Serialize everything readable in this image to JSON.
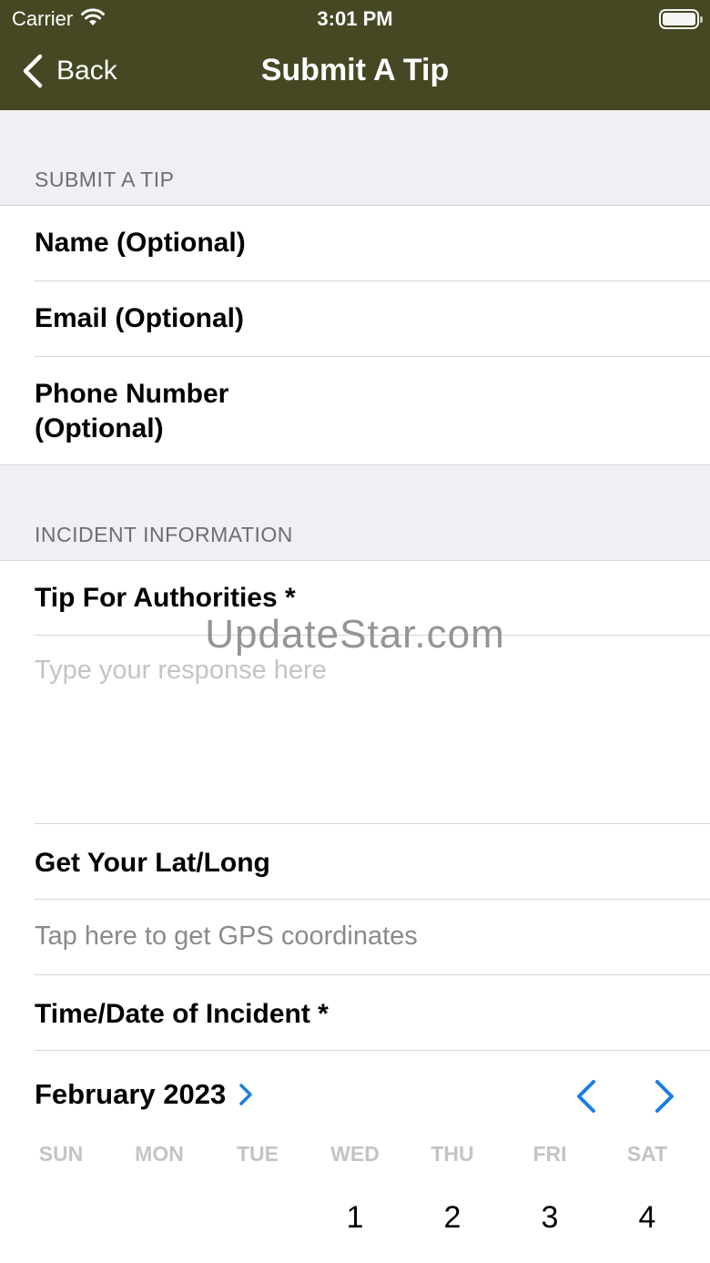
{
  "status_bar": {
    "carrier": "Carrier",
    "time": "3:01 PM"
  },
  "nav": {
    "back_label": "Back",
    "title": "Submit A Tip"
  },
  "sections": {
    "submit_tip": {
      "header": "SUBMIT A TIP",
      "fields": [
        "Name (Optional)",
        "Email (Optional)",
        "Phone Number\n(Optional)"
      ]
    },
    "incident": {
      "header": "INCIDENT INFORMATION",
      "tip_label": "Tip For Authorities *",
      "tip_placeholder": "Type your response here",
      "latlong_label": "Get Your Lat/Long",
      "gps_action": "Tap here to get GPS coordinates",
      "time_label": "Time/Date of Incident *"
    }
  },
  "watermark": "UpdateStar.com",
  "calendar": {
    "month": "February 2023",
    "weekdays": [
      "SUN",
      "MON",
      "TUE",
      "WED",
      "THU",
      "FRI",
      "SAT"
    ],
    "first_week": [
      "",
      "",
      "",
      "1",
      "2",
      "3",
      "4"
    ]
  },
  "colors": {
    "nav_bg": "#454823",
    "accent": "#1a7ee6",
    "section_bg": "#f0eff4"
  }
}
